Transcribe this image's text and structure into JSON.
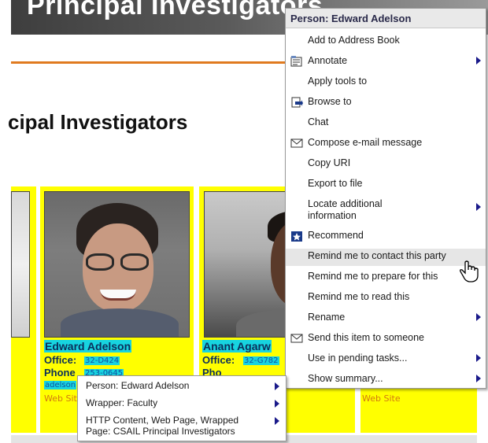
{
  "banner": {
    "title": "Principal Investigators"
  },
  "page": {
    "heading": "cipal Investigators"
  },
  "cards": [
    {
      "name": "Edward Adelson",
      "office_label": "Office:",
      "office_value": "32-D424",
      "phone_label": "Phone",
      "phone_value": "253-0645",
      "email_value": "adelson",
      "web_label": "Web Site"
    },
    {
      "name": "Anant Agarw",
      "office_label": "Office:",
      "office_value": "32-G782",
      "phone_label": "Pho",
      "web_label": "Web Site"
    }
  ],
  "context_menu": {
    "header": "Person: Edward Adelson",
    "items": [
      {
        "label": "Add to Address Book",
        "icon": "none",
        "submenu": false
      },
      {
        "label": "Annotate",
        "icon": "annotate-icon",
        "submenu": true
      },
      {
        "label": "Apply tools to",
        "icon": "none",
        "submenu": false
      },
      {
        "label": "Browse to",
        "icon": "browse-icon",
        "submenu": false
      },
      {
        "label": "Chat",
        "icon": "none",
        "submenu": false
      },
      {
        "label": "Compose e-mail message",
        "icon": "envelope-icon",
        "submenu": false
      },
      {
        "label": "Copy URI",
        "icon": "none",
        "submenu": false
      },
      {
        "label": "Export to file",
        "icon": "none",
        "submenu": false
      },
      {
        "label": "Locate additional",
        "label2": "information",
        "icon": "none",
        "submenu": true
      },
      {
        "label": "Recommend",
        "icon": "recommend-icon",
        "submenu": false
      },
      {
        "label": "Remind me to contact this party",
        "icon": "none",
        "submenu": false,
        "highlighted": true
      },
      {
        "label": "Remind me to prepare for this",
        "icon": "none",
        "submenu": false
      },
      {
        "label": "Remind me to read this",
        "icon": "none",
        "submenu": false
      },
      {
        "label": "Rename",
        "icon": "none",
        "submenu": true
      },
      {
        "label": "Send this item to someone",
        "icon": "envelope-icon",
        "submenu": false
      },
      {
        "label": "Use in pending tasks...",
        "icon": "none",
        "submenu": true
      },
      {
        "label": "Show summary...",
        "icon": "none",
        "submenu": true
      }
    ]
  },
  "popup_menu": {
    "items": [
      {
        "label": "Person: Edward Adelson",
        "submenu": true
      },
      {
        "label": "Wrapper: Faculty",
        "submenu": true
      },
      {
        "label": "HTTP Content, Web Page, Wrapped",
        "label2": "Page: CSAIL Principal Investigators",
        "submenu": true
      }
    ]
  },
  "colors": {
    "card_bg": "#ffff00",
    "highlight": "#17d4e0",
    "accent_rule": "#e07a1f",
    "menu_arrow": "#1a1a8a"
  }
}
